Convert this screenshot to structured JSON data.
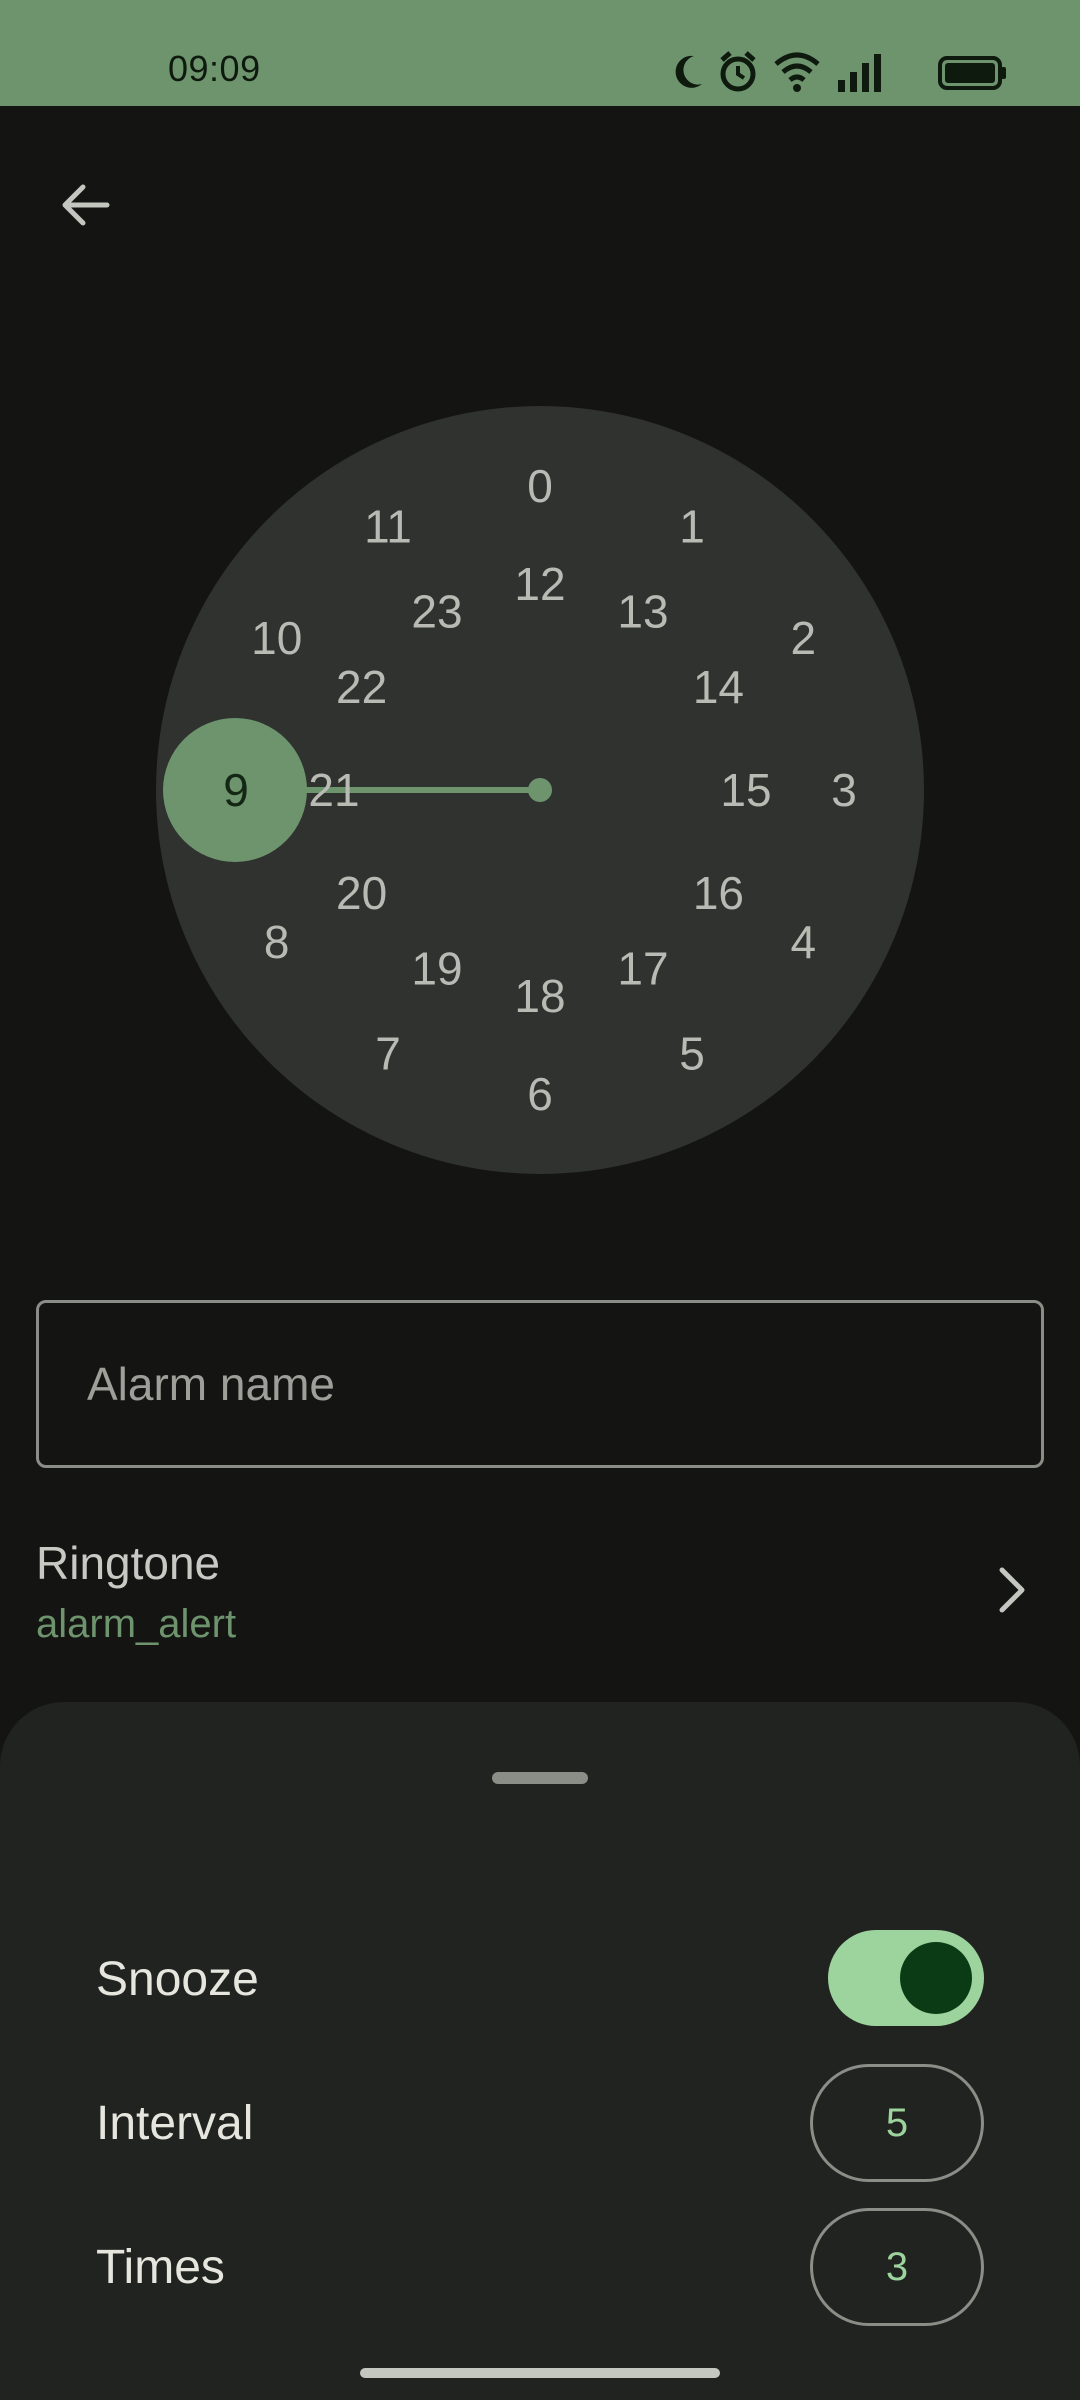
{
  "status_bar": {
    "time": "09:09",
    "icons": [
      "moon-icon",
      "alarm-clock-icon",
      "wifi-icon",
      "signal-icon",
      "battery-icon"
    ],
    "background": "#6e946e"
  },
  "toolbar": {
    "back_icon": "arrow-left-icon"
  },
  "clock": {
    "selected_hour": "9",
    "outer_ring": [
      "0",
      "1",
      "2",
      "3",
      "4",
      "5",
      "6",
      "7",
      "8",
      "9",
      "10",
      "11"
    ],
    "inner_ring": [
      "12",
      "13",
      "14",
      "15",
      "16",
      "17",
      "18",
      "19",
      "20",
      "21",
      "22",
      "23"
    ],
    "accent": "#6e946e",
    "face_color": "#2f322e"
  },
  "alarm_name": {
    "placeholder": "Alarm name",
    "value": ""
  },
  "ringtone": {
    "label": "Ringtone",
    "value": "alarm_alert",
    "chevron_icon": "chevron-right-icon"
  },
  "sheet": {
    "snooze_label": "Snooze",
    "snooze_enabled": true,
    "interval_label": "Interval",
    "interval_value": "5",
    "times_label": "Times",
    "times_value": "3"
  }
}
